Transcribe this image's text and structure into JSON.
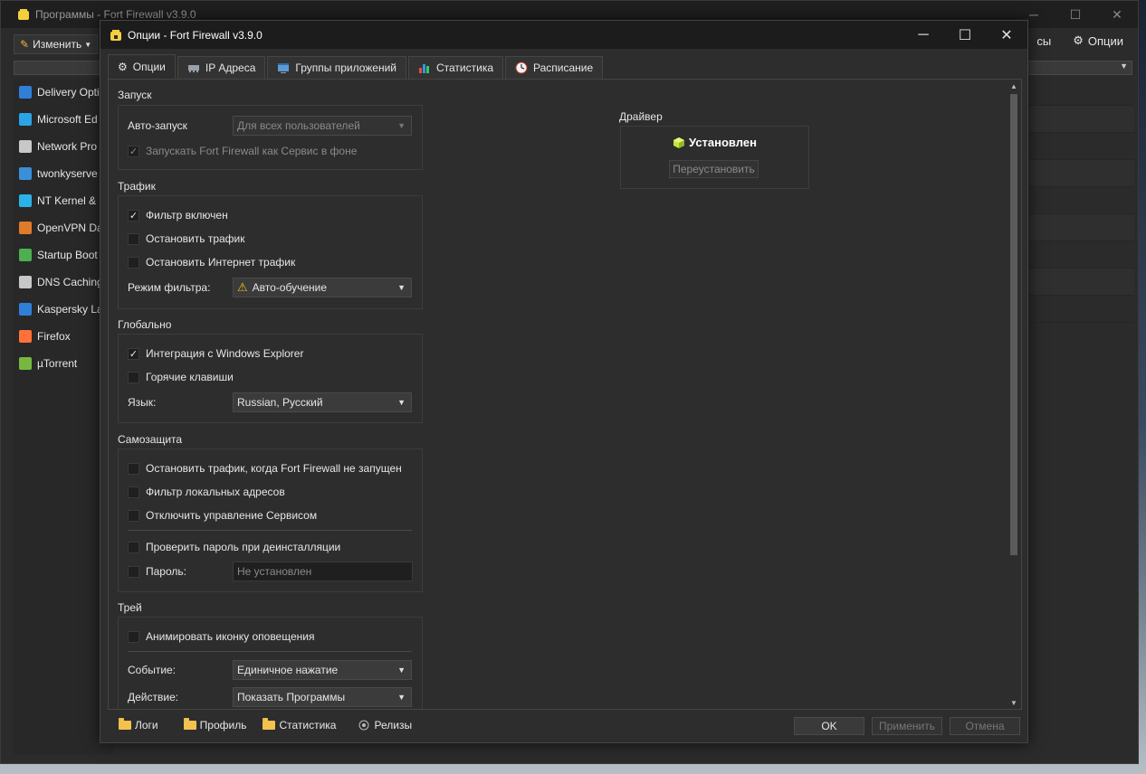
{
  "main_window": {
    "title": "Программы - Fort Firewall v3.9.0",
    "edit_button": "Изменить",
    "partial_label": "сы",
    "options_button": "Опции",
    "programs": [
      {
        "name": "Delivery Opti",
        "icon_color": "#2f7fd8"
      },
      {
        "name": "Microsoft Ed",
        "icon_color": "#2aa4e6"
      },
      {
        "name": "Network Pro",
        "icon_color": "#c8c8c8"
      },
      {
        "name": "twonkyserve",
        "icon_color": "#3b8fd9"
      },
      {
        "name": "NT Kernel &",
        "icon_color": "#2bb3e8"
      },
      {
        "name": "OpenVPN Da",
        "icon_color": "#e07b2a"
      },
      {
        "name": "Startup Boot",
        "icon_color": "#4caf50"
      },
      {
        "name": "DNS Caching",
        "icon_color": "#c8c8c8"
      },
      {
        "name": "Kaspersky La",
        "icon_color": "#2f7fd8"
      },
      {
        "name": "Firefox",
        "icon_color": "#ff7139"
      },
      {
        "name": "µTorrent",
        "icon_color": "#76b83f"
      }
    ]
  },
  "dialog": {
    "title": "Опции - Fort Firewall v3.9.0",
    "tabs": [
      {
        "label": "Опции",
        "icon": "gear-icon"
      },
      {
        "label": "IP Адреса",
        "icon": "network-card-icon"
      },
      {
        "label": "Группы приложений",
        "icon": "app-groups-icon"
      },
      {
        "label": "Статистика",
        "icon": "bar-chart-icon"
      },
      {
        "label": "Расписание",
        "icon": "clock-icon"
      }
    ],
    "startup": {
      "title": "Запуск",
      "autorun_label": "Авто-запуск",
      "autorun_value": "Для всех пользователей",
      "service_label": "Запускать Fort Firewall как Сервис в фоне"
    },
    "traffic": {
      "title": "Трафик",
      "filter_enabled": "Фильтр включен",
      "stop_traffic": "Остановить трафик",
      "stop_inet_traffic": "Остановить Интернет трафик",
      "filter_mode_label": "Режим фильтра:",
      "filter_mode_value": "Авто-обучение"
    },
    "global": {
      "title": "Глобально",
      "explorer_integration": "Интеграция с Windows Explorer",
      "hotkeys": "Горячие клавиши",
      "language_label": "Язык:",
      "language_value": "Russian, Русский"
    },
    "protection": {
      "title": "Самозащита",
      "stop_when_not_running": "Остановить трафик, когда Fort Firewall не запущен",
      "filter_local": "Фильтр локальных адресов",
      "disable_service_control": "Отключить управление Сервисом",
      "check_password_uninstall": "Проверить пароль при деинсталляции",
      "password_label": "Пароль:",
      "password_placeholder": "Не установлен"
    },
    "tray": {
      "title": "Трей",
      "animate_icon": "Анимировать иконку оповещения",
      "event_label": "Событие:",
      "event_value": "Единичное нажатие",
      "action_label": "Действие:",
      "action_value": "Показать Программы"
    },
    "driver": {
      "title": "Драйвер",
      "status": "Установлен",
      "reinstall": "Переустановить"
    },
    "bottom_links": {
      "logs": "Логи",
      "profile": "Профиль",
      "statistics": "Статистика",
      "releases": "Релизы"
    },
    "buttons": {
      "ok": "OK",
      "apply": "Применить",
      "cancel": "Отмена"
    }
  }
}
